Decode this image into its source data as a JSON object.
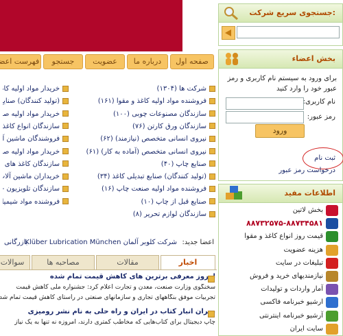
{
  "search": {
    "title": "جستجوی سریع شرکت:",
    "placeholder": ""
  },
  "nav": [
    "صفحه اول",
    "درباره ما",
    "عضویت",
    "جستجو",
    "فهرست اعضا"
  ],
  "members": {
    "title": "بخش اعضاء",
    "intro": "برای ورود به سیستم نام کاربری و رمز عبور خود را وارد کنید",
    "username_label": "نام کاربری:",
    "password_label": "رمز عبور:",
    "login_button": "ورود",
    "register_link": "ثبت نام",
    "forgot_link": "درخواست رمز عبور"
  },
  "useful": {
    "title": "اطلاعات مفید",
    "items": [
      "بخش لاتین",
      "۸۸۷۳۲۵۷۵-۸۸۷۳۴۵۸۱",
      "قیمت روز انواع کاغذ و مقوا",
      "هزینه عضویت",
      "تبلیغات در سایت",
      "نیازمندیهای خرید و فروش",
      "آمار واردات و تولیدات",
      "ارشیو خبرنامه فاکسی",
      "آرشیو خبرنامه اینترنتی",
      "سایت ایران"
    ]
  },
  "categories_right": [
    "شرکت ها (۱۳۰۴)",
    "فروشنده مواد اولیه کاغذ و مقوا (۱۶۱)",
    "سازندگان مصنوعات چوبی (۱۰۰)",
    "سازندگان ورق کارتن (۷۶)",
    "نیروی انسانی متخصص (نیازمند) (۶۲)",
    "نیروی انسانی متخصص (آماده به کار) (۶۱)",
    "صنایع چاپ (۴۰)",
    "(تولید کنندگان) صنایع تبدیلی کاغذ (۳۴)",
    "فروشنده مواد اولیه صنعت چاپ (۱۶)",
    "صنایع قبل از چاپ (۱۰)",
    "سازندگان لوازم تحریر (۸)"
  ],
  "categories_left": [
    "خریدار مواد اولیه کاغذ",
    "(تولید کنندگان) صنایع",
    "خریدار مواد اولیه صن",
    "سازندگان انواع کاغذ و",
    "فروشندگان ماشین آلا",
    "خریدار مواد اولیه صن",
    "سازندگان کاغذ های ب",
    "خریداران ماشین آلات",
    "سازندگان تلویزیون - روک",
    "فروشنده مواد شیمیا"
  ],
  "new_members": {
    "label": "اعضا جدید:",
    "item1": "شرکت کلوبر آلمان Klüber Lubrication München",
    "item2": "بازرگانی"
  },
  "tabs": [
    "اخبار",
    "مقالات",
    "مصاحبه ها",
    "سوالات"
  ],
  "news": [
    {
      "title": "امروز معرفی برترین های کاهش قیمت تمام شده",
      "body1": "سخنگوی وزارت صنعت، معدن و تجارت اعلام کرد: جشنواره ملی کاهش قیمت",
      "body2": "تجربیات موفق بنگاههای تجاری و سازمانهای صنعتی در راستای کاهش قیمت تمام شده"
    },
    {
      "title": "بحران انبار کتاب در ایران و راه حلی به نام نشر رومیزی",
      "body1": "چاپ دیجیتال برای کتاب‌هایی که مخاطب کمتری دارند، امروزه نه تنها به یک نیاز"
    }
  ]
}
